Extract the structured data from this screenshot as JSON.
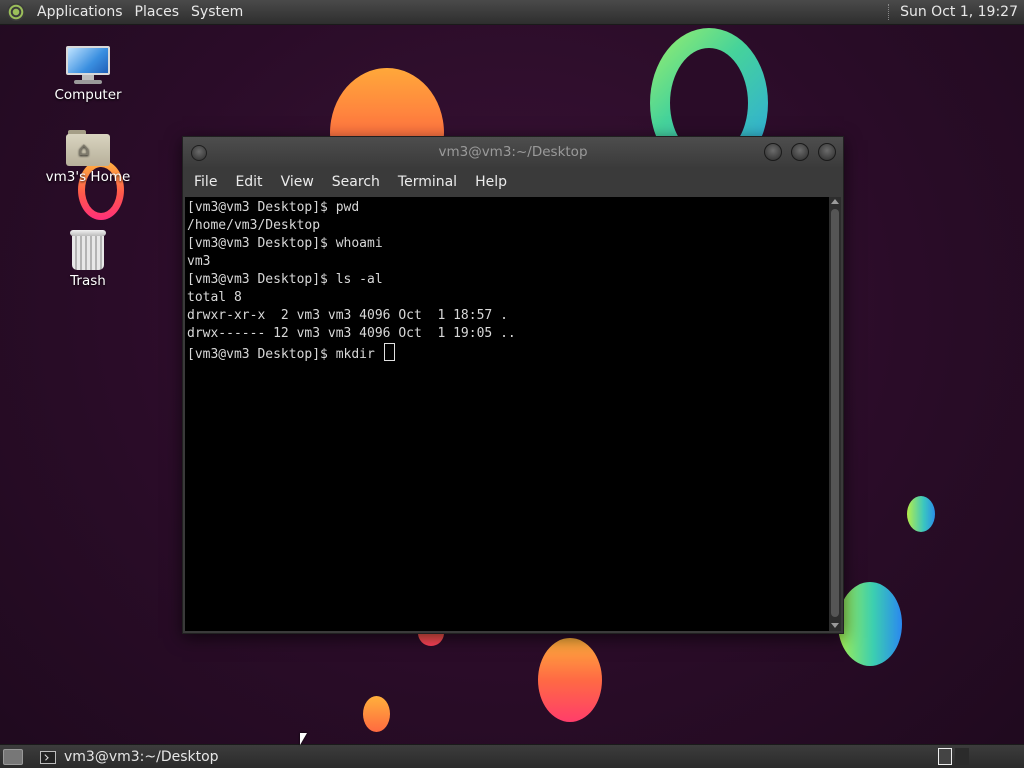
{
  "top_panel": {
    "menus": [
      "Applications",
      "Places",
      "System"
    ],
    "clock": "Sun Oct  1, 19:27"
  },
  "desktop_icons": [
    {
      "label": "Computer",
      "icon": "computer-icon"
    },
    {
      "label": "vm3's Home",
      "icon": "home-folder-icon"
    },
    {
      "label": "Trash",
      "icon": "trash-icon"
    }
  ],
  "terminal": {
    "title": "vm3@vm3:~/Desktop",
    "menu": [
      "File",
      "Edit",
      "View",
      "Search",
      "Terminal",
      "Help"
    ],
    "lines": [
      "[vm3@vm3 Desktop]$ pwd",
      "/home/vm3/Desktop",
      "[vm3@vm3 Desktop]$ whoami",
      "vm3",
      "[vm3@vm3 Desktop]$ ls -al",
      "total 8",
      "drwxr-xr-x  2 vm3 vm3 4096 Oct  1 18:57 .",
      "drwx------ 12 vm3 vm3 4096 Oct  1 19:05 ..",
      "[vm3@vm3 Desktop]$ mkdir "
    ]
  },
  "bottom_panel": {
    "taskbar_item": "vm3@vm3:~/Desktop"
  },
  "colors": {
    "desktop_background": "#2a0c28",
    "terminal_background": "#000000",
    "terminal_text": "#d8d8d8"
  }
}
